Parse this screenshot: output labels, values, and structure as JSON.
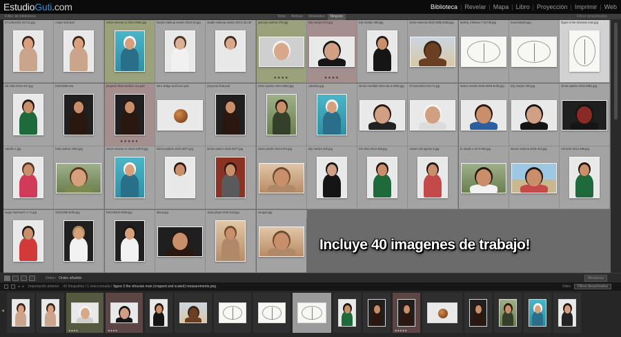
{
  "app": {
    "logo_main": "Estudio",
    "logo_accent": "Guti",
    "logo_domain": ".com",
    "modules": [
      "Biblioteca",
      "Revelar",
      "Mapa",
      "Libro",
      "Proyección",
      "Imprimir",
      "Web"
    ],
    "active_module": "Biblioteca",
    "accent_color": "#3b8fd1"
  },
  "filter_bar": {
    "title": "Filtro de biblioteca",
    "tabs": [
      "Texto",
      "Atributo",
      "Metadatos",
      "Ninguno"
    ],
    "active_tab": "Ninguno",
    "right_label": "Filtros desactivados"
  },
  "grid": {
    "rows": [
      [
        {
          "name": "ET4J3x4024-4271X.jpg",
          "orient": "portrait",
          "bg": "light",
          "skin": "#d9a07e",
          "hair": "#3a2418",
          "cloth": "#caa48b"
        },
        {
          "name": "mejor look.psd",
          "orient": "portrait",
          "bg": "light",
          "skin": "#d9a07e",
          "hair": "#3a2418",
          "cloth": "#caa48b"
        },
        {
          "name": "simon sesena ro 2014-0091.jpg",
          "orient": "portrait",
          "bg": "pool",
          "skin": "#d6a07c",
          "hair": "#ffffff",
          "cloth": "#2a6f8a",
          "mark": "green"
        },
        {
          "name": "studio makeup sesion 2014-31.jpg",
          "orient": "portrait",
          "bg": "light",
          "skin": "#dcb094",
          "hair": "#4a3224",
          "cloth": "#f1f1f1"
        },
        {
          "name": "studio makeup sesion 2014-32.nef",
          "orient": "portrait",
          "bg": "light",
          "skin": "#d8a888",
          "hair": "#3c2a20",
          "cloth": "#e8e8e8"
        },
        {
          "name": "gesurys andrea 276.jpg",
          "orient": "landscape",
          "bg": "mid",
          "skin": "#d7a98a",
          "hair": "#f5f5f5",
          "cloth": "#cfcfcf",
          "mark": "green",
          "stars": "★★★★"
        },
        {
          "name": "toly marlyn 571.jpg",
          "orient": "landscape",
          "bg": "light",
          "skin": "#d1a084",
          "hair": "#151515",
          "cloth": "#151515",
          "mark": "red",
          "stars": "★★★★"
        },
        {
          "name": "toly marlyn 460.jpg",
          "orient": "portrait",
          "bg": "light",
          "skin": "#c98f6b",
          "hair": "#231510",
          "cloth": "#151515"
        },
        {
          "name": "simon sesena 2015-3286.Edits.jpg",
          "orient": "landscape",
          "bg": "sand",
          "skin": "#6b3f22",
          "hair": "#3a2418",
          "cloth": "#6b3f22"
        },
        {
          "name": "lumibk_mitsona 7-02748.jpg",
          "orient": "landscape",
          "bg": "sketch",
          "skin": "#e5e5e5",
          "hair": "#888888",
          "cloth": "#e0d0d0"
        },
        {
          "name": "macrostudio.jpg",
          "orient": "landscape",
          "bg": "sketch",
          "skin": "#e5e5e5",
          "hair": "#888888",
          "cloth": "#e0d0d0"
        },
        {
          "name": "figure 3 the vitruvian man.jpg",
          "orient": "portrait",
          "bg": "sketch",
          "skin": "#d8d8d8",
          "hair": "#6a6a6a",
          "cloth": "#cfcfcf",
          "mark": "sel"
        }
      ],
      [
        {
          "name": "toli miss 2014-347.jpg",
          "orient": "portrait",
          "bg": "light",
          "skin": "#c98f6b",
          "hair": "#231510",
          "cloth": "#1f6a3b"
        },
        {
          "name": "DSC0658.arw",
          "orient": "portrait",
          "bg": "dark",
          "skin": "#c78c6a",
          "hair": "#2a1810",
          "cloth": "#2a1810"
        },
        {
          "name": "proyecto final medium res.psd",
          "orient": "portrait",
          "bg": "dark",
          "skin": "#c98f6b",
          "hair": "#2a1810",
          "cloth": "#2a1810",
          "mark": "red",
          "stars": "★★★★★"
        },
        {
          "name": "intro dodge and burn.psd",
          "orient": "landscape",
          "bg": "light",
          "skin": "#8a4a22",
          "hair": "#8a4a22",
          "cloth": "#e9e9e9",
          "ball": true
        },
        {
          "name": "proyecto final.psd",
          "orient": "portrait",
          "bg": "dark",
          "skin": "#c98f6b",
          "hair": "#2a1810",
          "cloth": "#2a1810"
        },
        {
          "name": "simon pastro 2014-3603.jpg",
          "orient": "portrait",
          "bg": "green",
          "skin": "#c98f6b",
          "hair": "#2a1810",
          "cloth": "#35402a"
        },
        {
          "name": "cabello2.jpg",
          "orient": "portrait",
          "bg": "pool",
          "skin": "#d6a07c",
          "hair": "#ffffff",
          "cloth": "#2a6f8a"
        },
        {
          "name": "simon merdital 2015 sta 3-3286.jpg",
          "orient": "landscape",
          "bg": "light",
          "skin": "#d1a084",
          "hair": "#2a1810",
          "cloth": "#222222"
        },
        {
          "name": "ET4J3x4024-4217X.jpg",
          "orient": "landscape",
          "bg": "light",
          "skin": "#d0a080",
          "hair": "#f5f5f5",
          "cloth": "#dcdcdc"
        },
        {
          "name": "sesion nessle 2015-3003-Edits.jpg",
          "orient": "landscape",
          "bg": "light",
          "skin": "#c98f6b",
          "hair": "#2a1810",
          "cloth": "#2c5fa0"
        },
        {
          "name": "toly marlyn 300.jpg",
          "orient": "landscape",
          "bg": "light",
          "skin": "#d1a084",
          "hair": "#151515",
          "cloth": "#151515"
        },
        {
          "name": "simon pastro 2015-2881.jpg",
          "orient": "landscape",
          "bg": "dark",
          "skin": "#8a2a24",
          "hair": "#151515",
          "cloth": "#151515"
        }
      ],
      [
        {
          "name": "cabello 1.jpg",
          "orient": "portrait",
          "bg": "light",
          "skin": "#c98f6b",
          "hair": "#5a3420",
          "cloth": "#d23a5a"
        },
        {
          "name": "hola andrea 4452.jpg",
          "orient": "landscape",
          "bg": "green",
          "skin": "#d6a07c",
          "hair": "#5a3420",
          "cloth": "#7a8a50"
        },
        {
          "name": "simon sesena ro 2016-13976.jpg",
          "orient": "portrait",
          "bg": "pool",
          "skin": "#d6a07c",
          "hair": "#ffffff",
          "cloth": "#2a6f8a"
        },
        {
          "name": "simon padres 2015-3877.jpg",
          "orient": "portrait",
          "bg": "light",
          "skin": "#c98f6b",
          "hair": "#2a1810",
          "cloth": "#e8e8e8"
        },
        {
          "name": "simon pastro 2015-3877.jpg",
          "orient": "portrait",
          "bg": "red",
          "skin": "#c98f6b",
          "hair": "#2a1810",
          "cloth": "#5a5a5a"
        },
        {
          "name": "simon pastro 2014-074.jpg",
          "orient": "landscape",
          "bg": "warm",
          "skin": "#c98f6b",
          "hair": "#6a4a30",
          "cloth": "#b0886a"
        },
        {
          "name": "toly marlyn 420.jpg",
          "orient": "portrait",
          "bg": "light",
          "skin": "#d1a084",
          "hair": "#151515",
          "cloth": "#151515"
        },
        {
          "name": "toli miss 2014-269.jpg",
          "orient": "portrait",
          "bg": "light",
          "skin": "#c98f6b",
          "hair": "#231510",
          "cloth": "#1f6a3b"
        },
        {
          "name": "sesion tod agosto 5.jpg",
          "orient": "portrait",
          "bg": "light",
          "skin": "#c98f6b",
          "hair": "#231510",
          "cloth": "#c44a4a"
        },
        {
          "name": "lic studio 1-32 0-094.jpg",
          "orient": "landscape",
          "bg": "green",
          "skin": "#c98f6b",
          "hair": "#231510",
          "cloth": "#f2f2f2"
        },
        {
          "name": "steven sesena 2015-443.jpg",
          "orient": "landscape",
          "bg": "sea",
          "skin": "#c98f6b",
          "hair": "#231510",
          "cloth": "#c44a4a"
        },
        {
          "name": "toli miss 2014-389.jpg",
          "orient": "portrait",
          "bg": "light",
          "skin": "#c98f6b",
          "hair": "#231510",
          "cloth": "#1f6a3b"
        }
      ],
      [
        {
          "name": "sugar sammuch 1-71.jpg",
          "orient": "portrait",
          "bg": "light",
          "skin": "#c98f6b",
          "hair": "#231510",
          "cloth": "#d23a3a"
        },
        {
          "name": "SSC2398-Edits.jpg",
          "orient": "portrait",
          "bg": "dark",
          "skin": "#d6a07c",
          "hair": "#b08a5a",
          "cloth": "#f2f2f2"
        },
        {
          "name": "DSC08404-Edits.jpg",
          "orient": "portrait",
          "bg": "dark",
          "skin": "#d6a07c",
          "hair": "#151515",
          "cloth": "#f2f2f2"
        },
        {
          "name": "diana.jpg",
          "orient": "landscape",
          "bg": "dark",
          "skin": "#c98f6b",
          "hair": "#2a1810",
          "cloth": "#2a1810"
        },
        {
          "name": "clase playa 2016-223.jpg",
          "orient": "portrait",
          "bg": "warm",
          "skin": "#c98f6b",
          "hair": "#6a4a30",
          "cloth": "#b0886a"
        },
        {
          "name": "arrugas.jpg",
          "orient": "landscape",
          "bg": "warm",
          "skin": "#c98f6b",
          "hair": "#6a4a30",
          "cloth": "#b0886a"
        }
      ]
    ]
  },
  "banner": {
    "text": "Incluye 40 imagenes de trabajo!"
  },
  "toolbar": {
    "sort_label": "Orden:",
    "sort_value": "Orden añadido",
    "right_label": "Miniaturas"
  },
  "filmstrip_header": {
    "source": "Importación anterior",
    "count": "42 fotografías / 1 seleccionada /",
    "selected_name": "figure 3 the vitruvian man (cropped and scaled) measurements.png",
    "filter_label": "Filtro:",
    "filter_value": "Filtros desactivados"
  },
  "filmstrip": [
    {
      "bg": "light",
      "skin": "#d9a07e",
      "hair": "#3a2418",
      "cloth": "#caa48b",
      "w": 26
    },
    {
      "bg": "light",
      "skin": "#d9a07e",
      "hair": "#3a2418",
      "cloth": "#caa48b",
      "w": 26
    },
    {
      "bg": "light",
      "skin": "#d7a98a",
      "hair": "#f5f5f5",
      "cloth": "#cfcfcf",
      "w": 40,
      "mark": "green",
      "stars": "★★★★"
    },
    {
      "bg": "light",
      "skin": "#d1a084",
      "hair": "#151515",
      "cloth": "#151515",
      "w": 40,
      "mark": "red",
      "stars": "★★★★"
    },
    {
      "bg": "light",
      "skin": "#c98f6b",
      "hair": "#231510",
      "cloth": "#151515",
      "w": 26
    },
    {
      "bg": "sand",
      "skin": "#6b3f22",
      "hair": "#3a2418",
      "cloth": "#6b3f22",
      "w": 40
    },
    {
      "bg": "sketch",
      "skin": "#e5e5e5",
      "hair": "#888888",
      "cloth": "#e0d0d0",
      "w": 40
    },
    {
      "bg": "sketch",
      "skin": "#e5e5e5",
      "hair": "#888888",
      "cloth": "#e0d0d0",
      "w": 40
    },
    {
      "bg": "sketch",
      "skin": "#d8d8d8",
      "hair": "#6a6a6a",
      "cloth": "#cfcfcf",
      "w": 42,
      "mark": "sel"
    },
    {
      "bg": "light",
      "skin": "#c98f6b",
      "hair": "#231510",
      "cloth": "#1f6a3b",
      "w": 26
    },
    {
      "bg": "dark",
      "skin": "#c78c6a",
      "hair": "#2a1810",
      "cloth": "#2a1810",
      "w": 26
    },
    {
      "bg": "dark",
      "skin": "#c98f6b",
      "hair": "#2a1810",
      "cloth": "#2a1810",
      "w": 26,
      "mark": "red",
      "stars": "★★★★★"
    },
    {
      "bg": "light",
      "skin": "#8a4a22",
      "hair": "#8a4a22",
      "cloth": "#e9e9e9",
      "w": 44,
      "ball": true
    },
    {
      "bg": "dark",
      "skin": "#c98f6b",
      "hair": "#2a1810",
      "cloth": "#2a1810",
      "w": 26
    },
    {
      "bg": "green",
      "skin": "#c98f6b",
      "hair": "#2a1810",
      "cloth": "#35402a",
      "w": 26
    },
    {
      "bg": "pool",
      "skin": "#d6a07c",
      "hair": "#ffffff",
      "cloth": "#2a6f8a",
      "w": 26
    },
    {
      "bg": "light",
      "skin": "#d1a084",
      "hair": "#2a1810",
      "cloth": "#222222",
      "w": 26
    }
  ]
}
